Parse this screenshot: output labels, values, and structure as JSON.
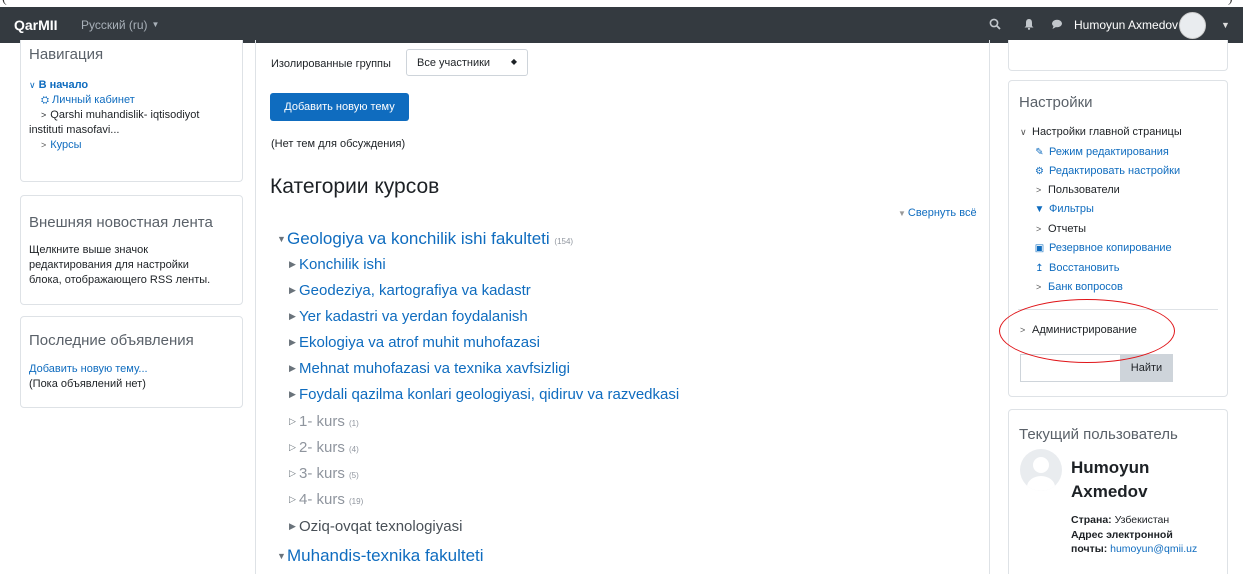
{
  "topstrip": {
    "left_char": "(",
    "right_char": ")"
  },
  "navbar": {
    "brand": "QarMII",
    "language": "Русский (ru)",
    "user_name": "Humoyun Axmedov",
    "icons": [
      "search-icon",
      "bell-icon",
      "chat-icon",
      "user-avatar",
      "caret-down-icon"
    ]
  },
  "left": {
    "navigation": {
      "title": "Навигация",
      "home": "В начало",
      "dashboard": "Личный кабинет",
      "site_line1": "Qarshi muhandislik- iqtisodiyot",
      "site_line2": "instituti masofavi...",
      "courses": "Курсы"
    },
    "rss": {
      "title": "Внешняя новостная лента",
      "line1": "Щелкните выше значок",
      "line2": "редактирования для настройки",
      "line3": "блока, отображающего RSS ленты."
    },
    "announcements": {
      "title": "Последние объявления",
      "add_link": "Добавить новую тему...",
      "empty": "(Пока объявлений нет)"
    }
  },
  "main": {
    "groups_label": "Изолированные группы",
    "groups_value": "Все участники",
    "add_topic_button": "Добавить новую тему",
    "no_topics": "(Нет тем для обсуждения)",
    "categories_heading": "Категории курсов",
    "collapse_all": "Свернуть всё",
    "categories": [
      {
        "name": "Geologiya va konchilik ishi fakulteti",
        "count": "(154)"
      },
      {
        "name": "Konchilik ishi"
      },
      {
        "name": "Geodeziya, kartografiya va kadastr"
      },
      {
        "name": "Yer kadastri va yerdan foydalanish"
      },
      {
        "name": "Ekologiya va atrof muhit muhofazasi"
      },
      {
        "name": "Mehnat muhofazasi va texnika xavfsizligi"
      },
      {
        "name": "Foydali qazilma konlari geologiyasi, qidiruv va razvedkasi"
      },
      {
        "name": "1- kurs",
        "count": "(1)"
      },
      {
        "name": "2- kurs",
        "count": "(4)"
      },
      {
        "name": "3- kurs",
        "count": "(5)"
      },
      {
        "name": "4- kurs",
        "count": "(19)"
      },
      {
        "name": "Oziq-ovqat texnologiyasi"
      },
      {
        "name": "Muhandis-texnika fakulteti"
      }
    ]
  },
  "right": {
    "settings": {
      "title": "Настройки",
      "section": "Настройки главной страницы",
      "items": [
        "Режим редактирования",
        "Редактировать настройки",
        "Пользователи",
        "Фильтры",
        "Отчеты",
        "Резервное копирование",
        "Восстановить",
        "Банк вопросов"
      ],
      "admin": "Администрирование",
      "search_button": "Найти"
    },
    "current_user": {
      "title": "Текущий пользователь",
      "first_name": "Humoyun",
      "last_name": "Axmedov",
      "country_label": "Страна:",
      "country": "Узбекистан",
      "email_label_1": "Адрес электронной",
      "email_label_2": "почты:",
      "email": "humoyun@qmii.uz"
    }
  },
  "colors": {
    "navbar": "#343a40",
    "link": "#0f6cbf",
    "annotation": "#e0161a"
  }
}
